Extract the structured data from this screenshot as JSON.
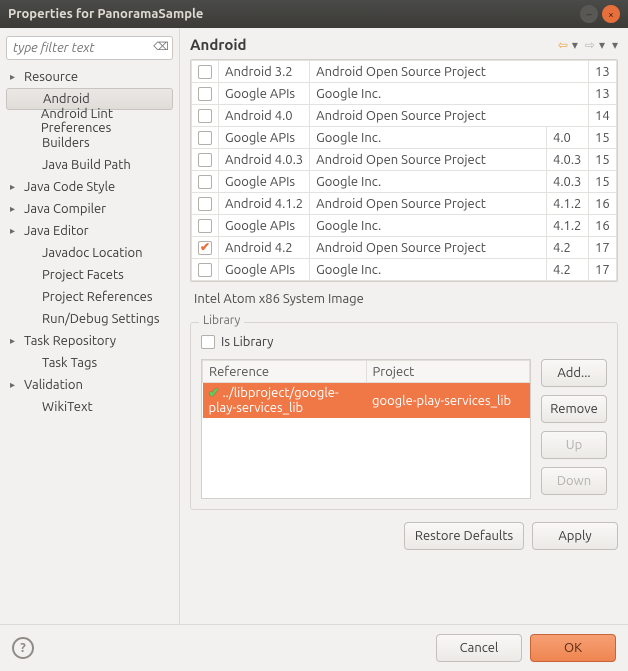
{
  "window": {
    "title": "Properties for PanoramaSample"
  },
  "sidebar": {
    "filter_placeholder": "type filter text",
    "items": [
      {
        "label": "Resource",
        "expandable": true
      },
      {
        "label": "Android",
        "selected": true
      },
      {
        "label": "Android Lint Preferences"
      },
      {
        "label": "Builders"
      },
      {
        "label": "Java Build Path"
      },
      {
        "label": "Java Code Style",
        "expandable": true
      },
      {
        "label": "Java Compiler",
        "expandable": true
      },
      {
        "label": "Java Editor",
        "expandable": true
      },
      {
        "label": "Javadoc Location"
      },
      {
        "label": "Project Facets"
      },
      {
        "label": "Project References"
      },
      {
        "label": "Run/Debug Settings"
      },
      {
        "label": "Task Repository",
        "expandable": true
      },
      {
        "label": "Task Tags"
      },
      {
        "label": "Validation",
        "expandable": true
      },
      {
        "label": "WikiText"
      }
    ]
  },
  "page": {
    "heading": "Android",
    "targets": [
      {
        "checked": false,
        "name": "Android 3.2",
        "vendor": "Android Open Source Project",
        "version": "",
        "api": "13"
      },
      {
        "checked": false,
        "name": "Google APIs",
        "vendor": "Google Inc.",
        "version": "",
        "api": "13"
      },
      {
        "checked": false,
        "name": "Android 4.0",
        "vendor": "Android Open Source Project",
        "version": "",
        "api": "14"
      },
      {
        "checked": false,
        "name": "Google APIs",
        "vendor": "Google Inc.",
        "version": "4.0",
        "api": "15"
      },
      {
        "checked": false,
        "name": "Android 4.0.3",
        "vendor": "Android Open Source Project",
        "version": "4.0.3",
        "api": "15"
      },
      {
        "checked": false,
        "name": "Google APIs",
        "vendor": "Google Inc.",
        "version": "4.0.3",
        "api": "15"
      },
      {
        "checked": false,
        "name": "Android 4.1.2",
        "vendor": "Android Open Source Project",
        "version": "4.1.2",
        "api": "16"
      },
      {
        "checked": false,
        "name": "Google APIs",
        "vendor": "Google Inc.",
        "version": "4.1.2",
        "api": "16"
      },
      {
        "checked": true,
        "name": "Android 4.2",
        "vendor": "Android Open Source Project",
        "version": "4.2",
        "api": "17"
      },
      {
        "checked": false,
        "name": "Google APIs",
        "vendor": "Google Inc.",
        "version": "4.2",
        "api": "17"
      }
    ],
    "system_image": "Intel Atom x86 System Image",
    "library": {
      "legend": "Library",
      "is_library_label": "Is Library",
      "is_library_checked": false,
      "columns": {
        "reference": "Reference",
        "project": "Project"
      },
      "rows": [
        {
          "reference": "../libproject/google-play-services_lib",
          "project": "google-play-services_lib",
          "selected": true
        }
      ],
      "buttons": {
        "add": "Add...",
        "remove": "Remove",
        "up": "Up",
        "down": "Down"
      }
    },
    "restore_defaults": "Restore Defaults",
    "apply": "Apply"
  },
  "footer": {
    "cancel": "Cancel",
    "ok": "OK"
  }
}
